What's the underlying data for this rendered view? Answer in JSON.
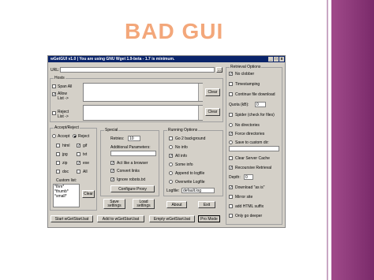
{
  "slide": {
    "title": "BAD GUI"
  },
  "window": {
    "title": "wGetGUI v1.0  |  You are using GNU Wget 1.9-beta - 1.7 is minimum.",
    "controls": [
      "_",
      "□",
      "x"
    ]
  },
  "url": {
    "label": "URL:",
    "value": "",
    "dots_button": "..."
  },
  "hosts": {
    "group_title": "Hosts",
    "span_all": "Span All",
    "allow_list": "Allow\nList ->",
    "reject_list": "Reject\nList ->",
    "clear1": "Clear",
    "clear2": "Clear"
  },
  "accept_reject": {
    "group_title": "Accept/Reject",
    "accept": "Accept",
    "reject": "Reject",
    "types": [
      {
        "label": "html",
        "checked": false
      },
      {
        "label": "gif",
        "checked": true
      },
      {
        "label": "jpg",
        "checked": false
      },
      {
        "label": "txt",
        "checked": false
      },
      {
        "label": "zip",
        "checked": false
      },
      {
        "label": "exe",
        "checked": true
      },
      {
        "label": "doc",
        "checked": false
      },
      {
        "label": "All",
        "checked": false
      }
    ],
    "custom_list_label": "Custom list:",
    "custom_list_value": "*thm*\n*thumb*\n*small*",
    "clear": "Clear"
  },
  "special": {
    "group_title": "Special",
    "retries_label": "Retries:",
    "retries_value": "10",
    "additional_params_label": "Additional Parameters:",
    "additional_params_value": "",
    "act_like_browser": "Act like a browser",
    "convert_links": "Convert links",
    "ignore_robots": "Ignore robots.txt",
    "configure_proxy": "Configure Proxy"
  },
  "running": {
    "group_title": "Running Options",
    "go2bg": "Go 2 background",
    "no_info": "No info",
    "all_info": "All info",
    "some_info": "Some info",
    "append_logfile": "Append to logfile",
    "overwrite_logfile": "Overwrite Logfile",
    "logfile_label": "Logfile:",
    "logfile_value": "default.log"
  },
  "buttons": {
    "save_settings": "Save\nsettings",
    "load_settings": "Load\nsettings",
    "about": "About",
    "exit": "Exit",
    "start_wgetstart": "Start wGetStart.bat",
    "add_wgetstart": "Add to wGetStart.bat",
    "empty_wgetstart": "Empty wGetStart.bat",
    "pro_mode": "Pro Mode"
  },
  "retrieval": {
    "group_title": "Retrieval Options",
    "no_clobber": "No clobber",
    "timestamping": "Timestamping",
    "continue_download": "Continue file download",
    "quota_label": "Quota (kB):",
    "quota_value": "0",
    "spider": "Spider (check for files)",
    "no_directories": "No directories",
    "force_directories": "Force directories",
    "save_custom_dir": "Save to custom dir:",
    "clear_server_cache": "Clear Server Cache",
    "recursive": "Recoursive Retrieval",
    "depth_label": "Depth:",
    "depth_value": "0",
    "download_asis": "Download \"as is\"",
    "mirror_site": "Mirror site",
    "add_html_suffix": "add HTML suffix",
    "only_go_deeper": "Only go deeper"
  }
}
